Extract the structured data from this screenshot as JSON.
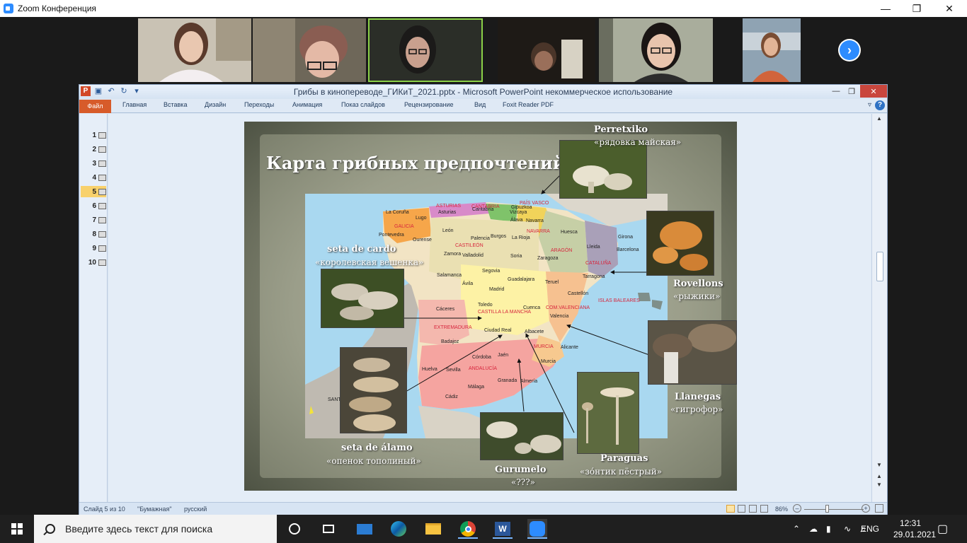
{
  "zoom": {
    "title": "Zoom Конференция"
  },
  "ppt": {
    "title": "Грибы в кинопереводе_ГИКиТ_2021.pptx  -  Microsoft PowerPoint некоммерческое использование",
    "tabs": [
      "Файл",
      "Главная",
      "Вставка",
      "Дизайн",
      "Переходы",
      "Анимация",
      "Показ слайдов",
      "Рецензирование",
      "Вид",
      "Foxit Reader PDF"
    ],
    "slides": [
      "1",
      "2",
      "3",
      "4",
      "5",
      "6",
      "7",
      "8",
      "9",
      "10"
    ],
    "selected_slide": 5,
    "status": {
      "slide_info": "Слайд 5 из 10",
      "theme": "\"Бумажная\"",
      "language": "русский",
      "zoom_percent": "86%"
    }
  },
  "slide": {
    "title": "Карта грибных предпочтений",
    "mushrooms": {
      "perretxiko": {
        "name": "Perretxiko",
        "ru": "«рядовка майская»"
      },
      "rovellons": {
        "name": "Rovellons",
        "ru": "«рыжики»"
      },
      "llanegas": {
        "name": "Llanegas",
        "ru": "«гигрофор»"
      },
      "paraguas": {
        "name": "Paraguas",
        "ru": "«зо́нтик пёстрый»"
      },
      "gurumelo": {
        "name": "Gurumelo",
        "ru": "«???»"
      },
      "alamo": {
        "name": "seta  de  álamo",
        "ru": "«опенок тополиный»"
      },
      "cardo": {
        "name": "seta de cardo",
        "ru": "«королевская вешенка»"
      }
    },
    "map_labels": {
      "asturias": "ASTURIAS",
      "cantabria": "CANTABRIA",
      "pais_vasco": "PAÍS VASCO",
      "galicia": "GALICIA",
      "navarra": "NAVARRA",
      "castleon": "CASTILEÓN",
      "aragon": "ARAGÓN",
      "cataluna": "CATALUÑA",
      "baleares": "ISLAS BALEARES",
      "valenciana": "COM.VALENCIANA",
      "castilla_mancha": "CASTILLA LA MANCHA",
      "extremadura": "EXTREMADURA",
      "murcia": "MURCIA",
      "andalucia": "ANDALUCÍA",
      "coruna": "La Coruña",
      "lugo": "Lugo",
      "pontevedra": "Pontevedra",
      "ourense": "Ourense",
      "leon": "León",
      "palencia": "Palencia",
      "burgos": "Burgos",
      "larioja": "La Rioja",
      "huesca": "Huesca",
      "lleida": "Lleida",
      "girona": "Girona",
      "barcelona": "Barcelona",
      "tarragona": "Tarragona",
      "zamora": "Zamora",
      "valladolid": "Valladolid",
      "soria": "Soria",
      "zaragoza": "Zaragoza",
      "salamanca": "Salamanca",
      "segovia": "Segovia",
      "guadalajara": "Guadalajara",
      "teruel": "Teruel",
      "avila": "Ávila",
      "madrid": "Madrid",
      "castellon": "Castellón",
      "caceres": "Cáceres",
      "toledo": "Toledo",
      "cuenca": "Cuenca",
      "valencia": "Valencia",
      "ciudad_real": "Ciudad Real",
      "albacete": "Albacete",
      "badajoz": "Badajoz",
      "alicante": "Alicante",
      "cordoba": "Córdoba",
      "jaen": "Jaén",
      "huelva": "Huelva",
      "sevilla": "Sevilla",
      "granada": "Granada",
      "almeria": "Almería",
      "malaga": "Málaga",
      "cadiz": "Cádiz",
      "murcia_city": "Murcia",
      "santa": "SANT",
      "gipuzkoa": "Gipuzkoa",
      "vizcaya": "Vizcaya",
      "alava": "Álava",
      "navarra_city": "Navarra",
      "asturias_city": "Asturias",
      "cantabria_city": "Cantabria"
    }
  },
  "taskbar": {
    "search_placeholder": "Введите здесь текст для поиска",
    "lang": "ENG",
    "time": "12:31",
    "date": "29.01.2021"
  }
}
